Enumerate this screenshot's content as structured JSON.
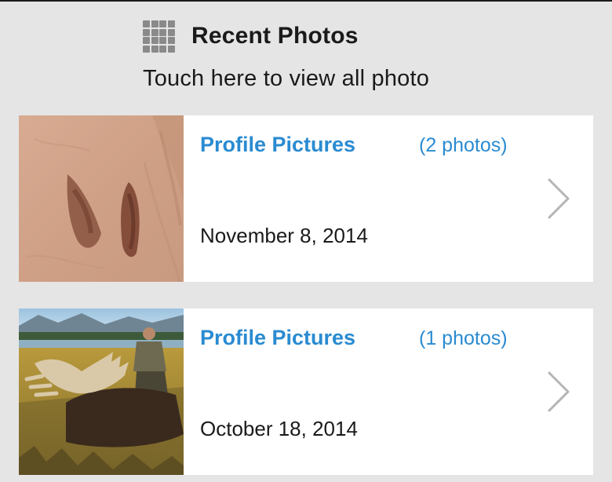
{
  "header": {
    "icon": "grid-icon",
    "title": "Recent Photos"
  },
  "view_all": {
    "label": "Touch here to view all photo"
  },
  "albums": [
    {
      "title": "Profile Pictures",
      "count": "(2 photos)",
      "date": "November 8, 2014",
      "thumbnail": "sand-track-photo",
      "chevron": "chevron-right-icon"
    },
    {
      "title": "Profile Pictures",
      "count": "(1 photos)",
      "date": "October 18, 2014",
      "thumbnail": "moose-hunt-photo",
      "chevron": "chevron-right-icon"
    }
  ],
  "colors": {
    "background": "#e5e5e5",
    "card": "#ffffff",
    "link_blue": "#2a8bd1",
    "chevron_gray": "#b5b5b5",
    "icon_gray": "#8a8a8a"
  }
}
